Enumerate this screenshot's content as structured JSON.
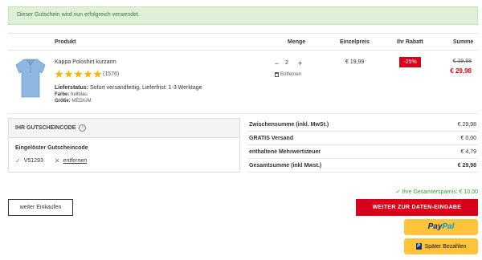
{
  "alert": {
    "message": "Dieser Gutschein wird nun erfolgreich verwendet."
  },
  "table_header": {
    "product": "Produkt",
    "quantity": "Menge",
    "unit_price": "Einzelpreis",
    "discount": "Ihr Rabatt",
    "sum": "Summe"
  },
  "cart_item": {
    "name": "Kappa Poloshirt kurzarm",
    "rating_stars": 5,
    "reviews": "(1576)",
    "status_label": "Lieferstatus:",
    "status_value": "Sofort versandfertig, Lieferfrist: 1-3 Werktage",
    "color_label": "Farbe:",
    "color_value": "hellblau",
    "size_label": "Größe:",
    "size_value": "MEDIUM",
    "qty_minus": "−",
    "quantity": "2",
    "qty_plus": "+",
    "remove": "Entfernen",
    "unit_price": "€ 19,99",
    "discount_badge": "-25%",
    "old_price": "€ 39,98",
    "new_price": "€ 29,98"
  },
  "coupon": {
    "heading": "IHR GUTSCHEINCODE",
    "info_icon": "i",
    "redeemed_label": "Eingelöster Gutscheincode",
    "check_icon": "✓",
    "code": "V51293",
    "x_icon": "✕",
    "remove_link": "entfernen"
  },
  "summary": {
    "subtotal_label": "Zwischensumme (inkl. MwSt.)",
    "subtotal_value": "€ 29,98",
    "shipping_label": "GRATIS Versand",
    "shipping_value": "€ 0,00",
    "vat_label": "enthaltene Mehrwertsteuer",
    "vat_value": "€ 4,79",
    "total_label": "Gesamtsumme (inkl Mwst.)",
    "total_value": "€ 29,98"
  },
  "savings": {
    "icon": "✓",
    "text": "Ihre Gesamtersparnis: € 10,00"
  },
  "buttons": {
    "continue": "weiter Einkaufen",
    "checkout": "WEITER ZUR DATEN-EINGABE",
    "paypal_pay": "Pay",
    "paypal_pal": "Pal",
    "paypal_later_icon": "P",
    "paypal_later": "Später Bezahlen"
  },
  "colors": {
    "accent_red": "#d9001b",
    "success_green": "#3c763d",
    "paypal_yellow": "#ffc439",
    "star_gold": "#f5b301"
  }
}
